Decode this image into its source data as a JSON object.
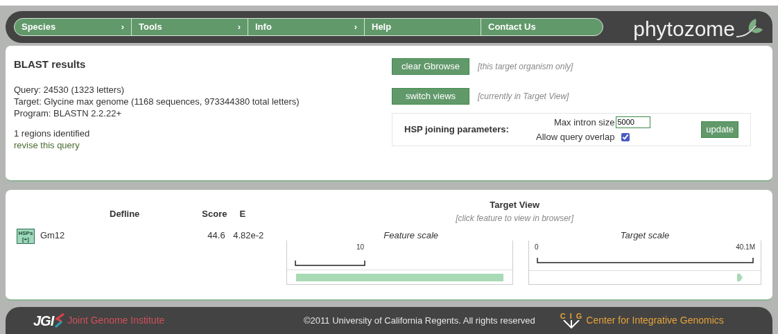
{
  "nav": {
    "items": [
      {
        "label": "Species",
        "arrow": "›"
      },
      {
        "label": "Tools",
        "arrow": "›"
      },
      {
        "label": "Info",
        "arrow": "›"
      },
      {
        "label": "Help"
      },
      {
        "label": "Contact Us"
      }
    ],
    "logo": "phytozome"
  },
  "summary": {
    "title": "BLAST results",
    "lines": [
      "Query: 24530 (1323 letters)",
      "Target: Glycine max genome (1168 sequences, 973344380 total letters)",
      "Program: BLASTN 2.2.22+"
    ],
    "regions": "1 regions identified",
    "revise_link": "revise this query"
  },
  "actions": [
    {
      "button": "clear Gbrowse",
      "note": "[this target organism only]"
    },
    {
      "button": "switch views",
      "note": "[currently in Target View]"
    }
  ],
  "hsp": {
    "label": "HSP joining parameters:",
    "intron_label": "Max intron size",
    "intron_value": "5000",
    "overlap_label": "Allow query overlap",
    "overlap_checked": true,
    "update": "update"
  },
  "results": {
    "columns": [
      "Defline",
      "Score",
      "E"
    ],
    "view_title": "Target View",
    "view_hint": "[click feature to view in browser]",
    "rows": [
      {
        "badge_top": "HSPs",
        "badge_bottom": "[+]",
        "defline": "Gm12",
        "score": "44.6",
        "e": "4.82e-2",
        "feature_scale": "Feature scale",
        "feature_tick": "10",
        "target_scale": "Target scale",
        "target_start": "0",
        "target_end": "40.1M"
      }
    ]
  },
  "footer": {
    "jgi_logo": "JGI",
    "jgi_name": "Joint Genome Institute",
    "copyright": "©2011 University of California Regents. All rights reserved",
    "cig_letters": [
      "C",
      "I",
      "G"
    ],
    "cig_name": "Center for Integrative Genomics"
  }
}
